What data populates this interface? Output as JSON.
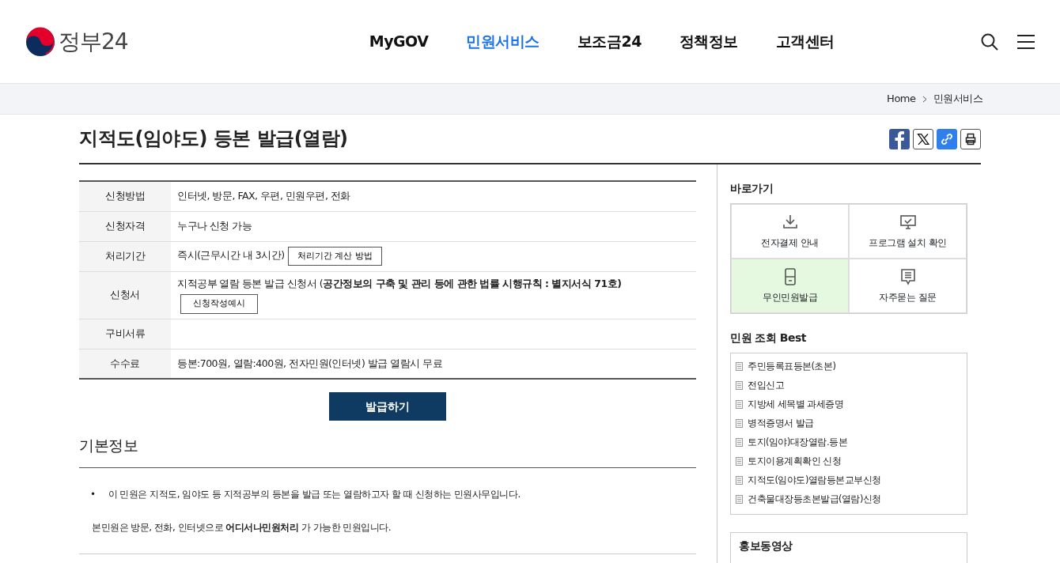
{
  "header": {
    "logo_text": "정부24",
    "nav": [
      {
        "label": "MyGOV",
        "selected": false
      },
      {
        "label": "민원서비스",
        "selected": true
      },
      {
        "label": "보조금24",
        "selected": false
      },
      {
        "label": "정책정보",
        "selected": false
      },
      {
        "label": "고객센터",
        "selected": false
      }
    ]
  },
  "breadcrumb": [
    "Home",
    "민원서비스"
  ],
  "page_title": "지적도(임야도) 등본 발급(열람)",
  "share": [
    {
      "kind": "facebook"
    },
    {
      "kind": "x"
    },
    {
      "kind": "link"
    },
    {
      "kind": "print"
    }
  ],
  "info_table": [
    {
      "label": "신청방법",
      "value": "인터넷, 방문, FAX, 우편, 민원우편, 전화"
    },
    {
      "label": "신청자격",
      "value": "누구나 신청 가능"
    },
    {
      "label": "처리기간",
      "value": "즉시(근무시간 내 3시간)",
      "button": "처리기간 계산 방법"
    },
    {
      "label": "신청서",
      "value": "지적공부 열람 등본 발급 신청서 (**공간정보의 구축 및 관리 등에 관한 법률 시행규칙 : 별지서식 71호)**",
      "button": "신청작성예시",
      "button_below": true
    },
    {
      "label": "구비서류"
    },
    {
      "label": "수수료",
      "value": "등본:700원, 열람:400원, 전자민원(인터넷) 발급 열람시 무료"
    }
  ],
  "apply_button": "발급하기",
  "basic_info": {
    "title": "기본정보",
    "bullet_mark": "•",
    "bullet": "이 민원은 지적도, 임야도 등 지적공부의 등본을 발급 또는 열람하고자 할 때 신청하는 민원사무입니다.",
    "note": "본민원은 방문, 전화, 인터넷으로 **어디서나민원처리** 가 가능한 민원입니다."
  },
  "quick_links": {
    "title": "바로가기",
    "items": [
      {
        "label": "전자결제 안내",
        "kind": "download",
        "highlighted": false
      },
      {
        "label": "프로그램 설치 확인",
        "kind": "monitor",
        "highlighted": false
      },
      {
        "label": "무인민원발급",
        "kind": "kiosk",
        "highlighted": true
      },
      {
        "label": "자주묻는 질문",
        "kind": "chat",
        "highlighted": false
      }
    ]
  },
  "best": {
    "title": "민원 조회 Best",
    "items": [
      "주민등록표등본(초본)",
      "전입신고",
      "지방세 세목별 과세증명",
      "병적증명서 발급",
      "토지(임야)대장열람.등본",
      "토지이용계획확인 신청",
      "지적도(임야도)열람등본교부신청",
      "건축물대장등초본발급(열람)신청"
    ]
  },
  "video": {
    "title": "홍보동영상"
  }
}
